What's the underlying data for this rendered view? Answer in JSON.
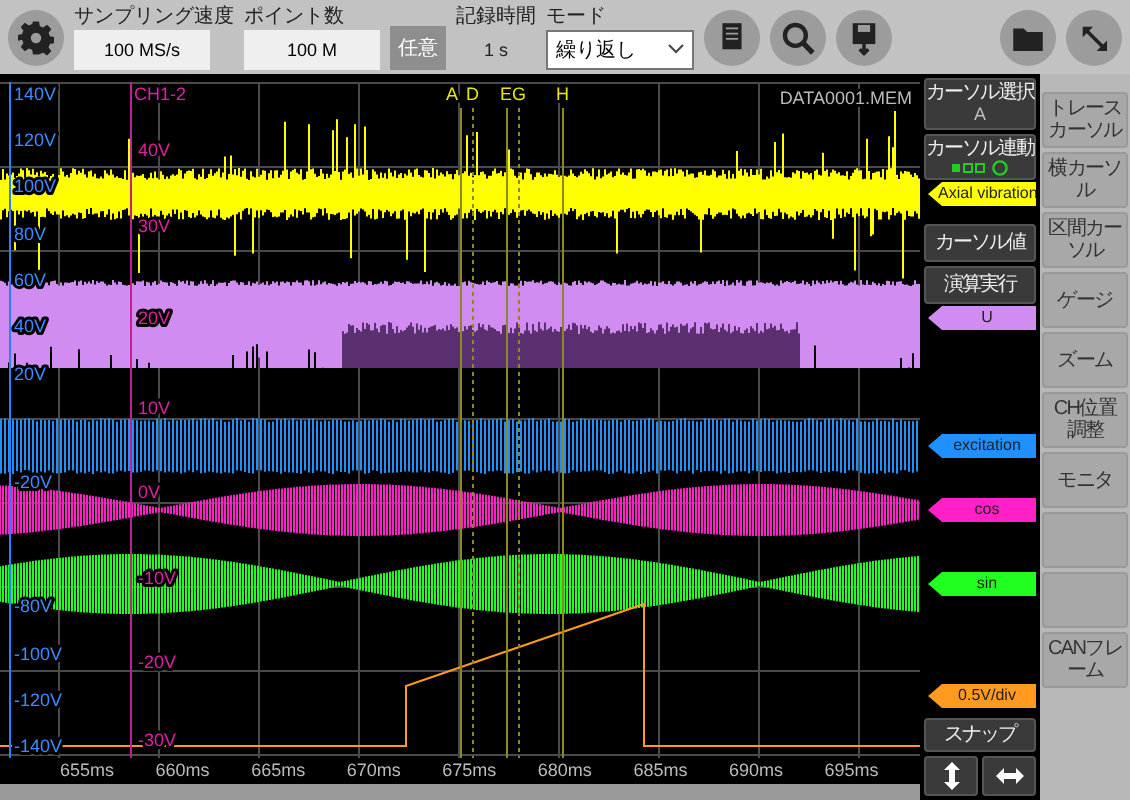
{
  "toolbar": {
    "sampling_rate": {
      "label": "サンプリング速度",
      "value": "100 MS/s"
    },
    "points": {
      "label": "ポイント数",
      "value": "100 M"
    },
    "arbitrary_button": "任意",
    "record_time": {
      "label": "記録時間",
      "value": "1 s"
    },
    "mode": {
      "label": "モード",
      "value": "繰り返し"
    }
  },
  "plot": {
    "file_name": "DATA0001.MEM",
    "channel_title": "CH1-2",
    "left_scale": [
      "140V",
      "120V",
      "100V",
      "80V",
      "60V",
      "40V",
      "20V",
      "-20V",
      "-80V",
      "-100V",
      "-120V",
      "-140V"
    ],
    "right_scale": [
      "40V",
      "30V",
      "20V",
      "10V",
      "0V",
      "-10V",
      "-20V",
      "-30V"
    ],
    "cursors": [
      "A",
      "D",
      "E",
      "G",
      "H"
    ],
    "time_axis": [
      "655ms",
      "660ms",
      "665ms",
      "670ms",
      "675ms",
      "680ms",
      "685ms",
      "690ms",
      "695ms"
    ]
  },
  "cursor_panel": {
    "cursor_select": {
      "label": "カーソル選択",
      "value": "A"
    },
    "cursor_link": "カーソル連動",
    "cursor_value_button": "カーソル値",
    "compute_button": "演算実行",
    "snap_button": "スナップ"
  },
  "channel_tags": [
    {
      "label": "Axial vibration",
      "color": "#ffff00"
    },
    {
      "label": "U",
      "color": "#d08cf0"
    },
    {
      "label": "excitation",
      "color": "#1e90ff"
    },
    {
      "label": "cos",
      "color": "#ff20c8"
    },
    {
      "label": "sin",
      "color": "#20ff20"
    },
    {
      "label": "0.5V/div",
      "color": "#ff9a1e"
    }
  ],
  "menu": [
    {
      "kind": "button",
      "label": "トレースカーソル"
    },
    {
      "kind": "button",
      "label": "横カーソル"
    },
    {
      "kind": "button",
      "label": "区間カーソル"
    },
    {
      "kind": "button",
      "label": "ゲージ"
    },
    {
      "kind": "button",
      "label": "ズーム"
    },
    {
      "kind": "button",
      "label": "CH位置調整"
    },
    {
      "kind": "button",
      "label": "モニタ"
    },
    {
      "kind": "blank"
    },
    {
      "kind": "blank"
    },
    {
      "kind": "button",
      "label": "CANフレーム"
    }
  ]
}
